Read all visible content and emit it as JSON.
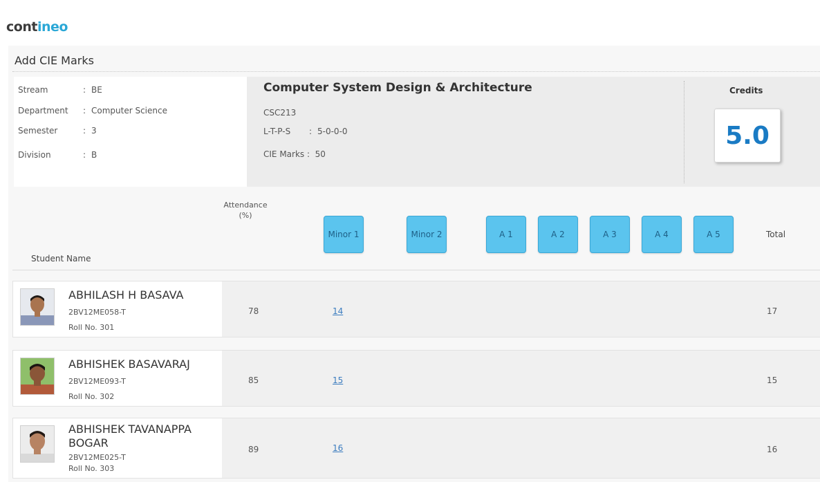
{
  "logo": {
    "part1": "cont",
    "part2": "ineo"
  },
  "page_title": "Add CIE Marks",
  "info": {
    "stream": {
      "label": "Stream",
      "value": "BE"
    },
    "department": {
      "label": "Department",
      "value": "Computer Science"
    },
    "semester": {
      "label": "Semester",
      "value": "3"
    },
    "division": {
      "label": "Division",
      "value": "B"
    },
    "separator": ":"
  },
  "course": {
    "title": "Computer System Design & Architecture",
    "code": "CSC213",
    "ltps": {
      "label": "L-T-P-S",
      "value": "5-0-0-0"
    },
    "cie_marks": {
      "label": "CIE Marks",
      "value": "50"
    }
  },
  "credits": {
    "label": "Credits",
    "value": "5.0"
  },
  "columns": {
    "student_name": "Student Name",
    "attendance_line1": "Attendance",
    "attendance_line2": "(%)",
    "minor1": "Minor 1",
    "minor2": "Minor 2",
    "a1": "A 1",
    "a2": "A 2",
    "a3": "A 3",
    "a4": "A 4",
    "a5": "A 5",
    "total": "Total"
  },
  "students": [
    {
      "name": "ABHILASH H BASAVA",
      "usn": "2BV12ME058-T",
      "roll": "Roll No.  301",
      "attendance": "78",
      "minor1": "14",
      "total": "17"
    },
    {
      "name": "ABHISHEK BASAVARAJ",
      "usn": "2BV12ME093-T",
      "roll": "Roll No.  302",
      "attendance": "85",
      "minor1": "15",
      "total": "15"
    },
    {
      "name": "ABHISHEK TAVANAPPA BOGAR",
      "usn": "2BV12ME025-T",
      "roll": "Roll No.  303",
      "attendance": "89",
      "minor1": "16",
      "total": "16"
    }
  ],
  "colors": {
    "accent": "#5bc4ee",
    "credits_text": "#1a7bc4",
    "link": "#3a7bbf"
  }
}
